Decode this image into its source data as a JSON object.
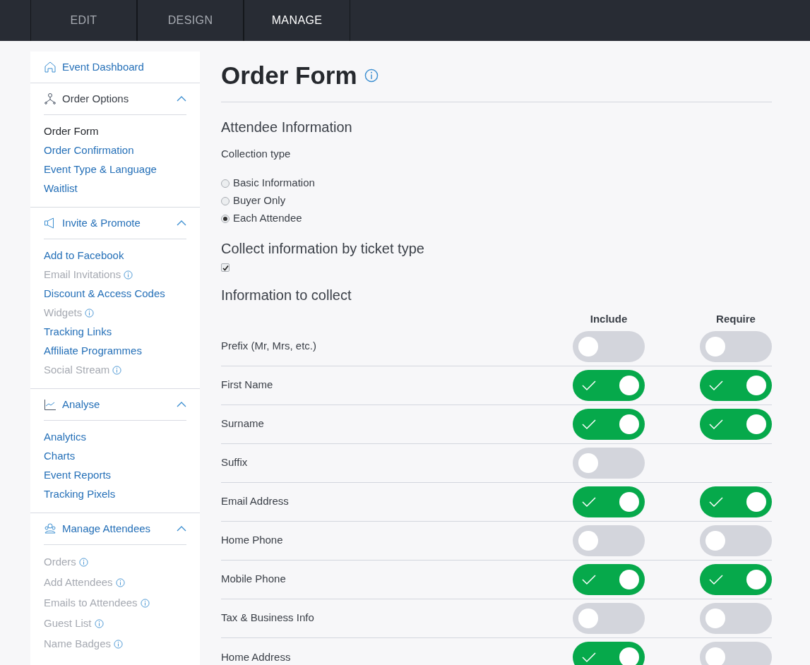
{
  "top_tabs": [
    {
      "label": "EDIT",
      "selected": false
    },
    {
      "label": "DESIGN",
      "selected": false
    },
    {
      "label": "MANAGE",
      "selected": true
    }
  ],
  "sidebar": {
    "dashboard": {
      "label": "Event Dashboard"
    },
    "groups": [
      {
        "heading": "Order Options",
        "expanded": true,
        "items": [
          {
            "label": "Order Form",
            "selected": true,
            "disabled": false,
            "info": false
          },
          {
            "label": "Order Confirmation",
            "selected": false,
            "disabled": false,
            "info": false
          },
          {
            "label": "Event Type & Language",
            "selected": false,
            "disabled": false,
            "info": false
          },
          {
            "label": "Waitlist",
            "selected": false,
            "disabled": false,
            "info": false
          }
        ]
      },
      {
        "heading": "Invite & Promote",
        "expanded": true,
        "items": [
          {
            "label": "Add to Facebook",
            "selected": false,
            "disabled": false,
            "info": false
          },
          {
            "label": "Email Invitations",
            "selected": false,
            "disabled": true
          },
          {
            "label": "Discount & Access Codes",
            "selected": false,
            "disabled": false,
            "info": false
          },
          {
            "label": "Widgets",
            "selected": false,
            "disabled": true
          },
          {
            "label": "Tracking Links",
            "selected": false,
            "disabled": false,
            "info": false
          },
          {
            "label": "Affiliate Programmes",
            "selected": false,
            "disabled": false,
            "info": false
          },
          {
            "label": "Social Stream",
            "selected": false,
            "disabled": true
          }
        ]
      },
      {
        "heading": "Analyse",
        "expanded": true,
        "items": [
          {
            "label": "Analytics",
            "selected": false,
            "disabled": false,
            "info": false
          },
          {
            "label": "Charts",
            "selected": false,
            "disabled": false,
            "info": false
          },
          {
            "label": "Event Reports",
            "selected": false,
            "disabled": false,
            "info": false
          },
          {
            "label": "Tracking Pixels",
            "selected": false,
            "disabled": false,
            "info": false
          }
        ]
      },
      {
        "heading": "Manage Attendees",
        "expanded": true,
        "items": [
          {
            "label": "Orders",
            "selected": false,
            "disabled": true
          },
          {
            "label": "Add Attendees",
            "selected": false,
            "disabled": true
          },
          {
            "label": "Emails to Attendees",
            "selected": false,
            "disabled": true
          },
          {
            "label": "Guest List",
            "selected": false,
            "disabled": true
          },
          {
            "label": "Name Badges",
            "selected": false,
            "disabled": true
          }
        ]
      }
    ]
  },
  "main": {
    "title": "Order Form",
    "attendee_section": {
      "heading": "Attendee Information",
      "collection_label": "Collection type",
      "options": [
        {
          "label": "Basic Information",
          "selected": false
        },
        {
          "label": "Buyer Only",
          "selected": false
        },
        {
          "label": "Each Attendee",
          "selected": true
        }
      ]
    },
    "by_ticket": {
      "heading": "Collect information by ticket type",
      "checked": true
    },
    "collect": {
      "heading": "Information to collect",
      "columns": [
        "Include",
        "Require"
      ],
      "rows": [
        {
          "label": "Prefix (Mr, Mrs, etc.)",
          "include": false,
          "require": false
        },
        {
          "label": "First Name",
          "include": true,
          "require": true
        },
        {
          "label": "Surname",
          "include": true,
          "require": true
        },
        {
          "label": "Suffix",
          "include": false
        },
        {
          "label": "Email Address",
          "include": true,
          "require": true
        },
        {
          "label": "Home Phone",
          "include": false,
          "require": false
        },
        {
          "label": "Mobile Phone",
          "include": true,
          "require": true
        },
        {
          "label": "Tax & Business Info",
          "include": false,
          "require": false
        },
        {
          "label": "Home Address",
          "include": true,
          "require": false
        }
      ]
    }
  }
}
